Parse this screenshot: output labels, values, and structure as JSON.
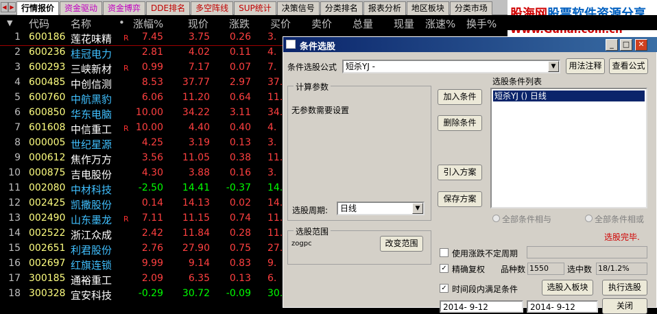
{
  "tabs": [
    {
      "label": "行情报价",
      "color": "#000000"
    },
    {
      "label": "资金驱动",
      "color": "#c000c0"
    },
    {
      "label": "资金博弈",
      "color": "#c000c0"
    },
    {
      "label": "DDE排名",
      "color": "#c00000"
    },
    {
      "label": "多空阵线",
      "color": "#c00000"
    },
    {
      "label": "SUP统计",
      "color": "#c00000"
    },
    {
      "label": "决策信号",
      "color": "#000000"
    },
    {
      "label": "分类排名",
      "color": "#000000"
    },
    {
      "label": "报表分析",
      "color": "#000000"
    },
    {
      "label": "地区板块",
      "color": "#000000"
    },
    {
      "label": "分类市场",
      "color": "#000000"
    }
  ],
  "logo": {
    "line1a": "股海网",
    "line1b": "股票软件资源分享",
    "line2": "Www.Guhai.com.cn"
  },
  "header": {
    "arrow": "▼",
    "code": "代码",
    "name": "名称",
    "dot": "•",
    "pct": "涨幅%",
    "price": "现价",
    "chg": "涨跌",
    "bid": "买价",
    "ask": "卖价",
    "vol": "总量",
    "cur": "现量",
    "speed": "涨速%",
    "turn": "换手%"
  },
  "rows": [
    {
      "idx": "1",
      "code": "600186",
      "name": "莲花味精",
      "r": "R",
      "pct": "7.45",
      "price": "3.75",
      "chg": "0.26",
      "bid": "3.",
      "nameColor": "#ffffff"
    },
    {
      "idx": "2",
      "code": "600236",
      "name": "桂冠电力",
      "r": "",
      "pct": "2.81",
      "price": "4.02",
      "chg": "0.11",
      "bid": "4.",
      "nameColor": "#40c0ff"
    },
    {
      "idx": "3",
      "code": "600293",
      "name": "三峡新材",
      "r": "R",
      "pct": "0.99",
      "price": "7.17",
      "chg": "0.07",
      "bid": "7.",
      "nameColor": "#ffffff"
    },
    {
      "idx": "4",
      "code": "600485",
      "name": "中创信测",
      "r": "",
      "pct": "8.53",
      "price": "37.77",
      "chg": "2.97",
      "bid": "37.",
      "nameColor": "#ffffff"
    },
    {
      "idx": "5",
      "code": "600760",
      "name": "中航黑豹",
      "r": "",
      "pct": "6.06",
      "price": "11.20",
      "chg": "0.64",
      "bid": "11.",
      "nameColor": "#40c0ff"
    },
    {
      "idx": "6",
      "code": "600850",
      "name": "华东电脑",
      "r": "",
      "pct": "10.00",
      "price": "34.22",
      "chg": "3.11",
      "bid": "34.",
      "nameColor": "#40c0ff"
    },
    {
      "idx": "7",
      "code": "601608",
      "name": "中信重工",
      "r": "R",
      "pct": "10.00",
      "price": "4.40",
      "chg": "0.40",
      "bid": "4.",
      "nameColor": "#ffffff"
    },
    {
      "idx": "8",
      "code": "000005",
      "name": "世纪星源",
      "r": "",
      "pct": "4.25",
      "price": "3.19",
      "chg": "0.13",
      "bid": "3.",
      "nameColor": "#40c0ff"
    },
    {
      "idx": "9",
      "code": "000612",
      "name": "焦作万方",
      "r": "",
      "pct": "3.56",
      "price": "11.05",
      "chg": "0.38",
      "bid": "11.",
      "nameColor": "#ffffff"
    },
    {
      "idx": "10",
      "code": "000875",
      "name": "吉电股份",
      "r": "",
      "pct": "4.30",
      "price": "3.88",
      "chg": "0.16",
      "bid": "3.",
      "nameColor": "#ffffff"
    },
    {
      "idx": "11",
      "code": "002080",
      "name": "中材科技",
      "r": "",
      "pct": "-2.50",
      "price": "14.41",
      "chg": "-0.37",
      "bid": "14.",
      "nameColor": "#40c0ff"
    },
    {
      "idx": "12",
      "code": "002425",
      "name": "凯撒股份",
      "r": "",
      "pct": "0.14",
      "price": "14.13",
      "chg": "0.02",
      "bid": "14.",
      "nameColor": "#40c0ff"
    },
    {
      "idx": "13",
      "code": "002490",
      "name": "山东墨龙",
      "r": "R",
      "pct": "7.11",
      "price": "11.15",
      "chg": "0.74",
      "bid": "11.",
      "nameColor": "#40c0ff"
    },
    {
      "idx": "14",
      "code": "002522",
      "name": "浙江众成",
      "r": "",
      "pct": "2.42",
      "price": "11.84",
      "chg": "0.28",
      "bid": "11.",
      "nameColor": "#ffffff"
    },
    {
      "idx": "15",
      "code": "002651",
      "name": "利君股份",
      "r": "",
      "pct": "2.76",
      "price": "27.90",
      "chg": "0.75",
      "bid": "27.",
      "nameColor": "#40c0ff"
    },
    {
      "idx": "16",
      "code": "002697",
      "name": "红旗连锁",
      "r": "",
      "pct": "9.99",
      "price": "9.14",
      "chg": "0.83",
      "bid": "9.",
      "nameColor": "#40c0ff"
    },
    {
      "idx": "17",
      "code": "300185",
      "name": "通裕重工",
      "r": "",
      "pct": "2.09",
      "price": "6.35",
      "chg": "0.13",
      "bid": "6.",
      "nameColor": "#ffffff"
    },
    {
      "idx": "18",
      "code": "300328",
      "name": "宜安科技",
      "r": "",
      "pct": "-0.29",
      "price": "30.72",
      "chg": "-0.09",
      "bid": "30.",
      "nameColor": "#ffffff"
    }
  ],
  "colors": {
    "up": "#ff4040",
    "down": "#00ff00",
    "code": "#ffff80",
    "index": "#c0c0c0"
  },
  "dialog": {
    "title": "条件选股",
    "formula_label": "条件选股公式",
    "formula_value": "短杀YJ  -",
    "usage_btn": "用法注释",
    "view_btn": "查看公式",
    "params_title": "计算参数",
    "no_params": "无参数需要设置",
    "add_btn": "加入条件",
    "del_btn": "删除条件",
    "import_btn": "引入方案",
    "save_btn": "保存方案",
    "list_title": "选股条件列表",
    "list_item": "短杀YJ () 日线",
    "period_label": "选股周期:",
    "period_value": "日线",
    "radio_and": "全部条件相与",
    "radio_or": "全部条件相或",
    "scope_title": "选股范围",
    "scope_value": "zogpc",
    "change_scope_btn": "改变范围",
    "done_text": "选股完毕.",
    "use_unfixed": "使用涨跌不定周期",
    "exact_fq": "精确复权",
    "kinds_label": "品种数",
    "kinds_value": "1550",
    "selected_label": "选中数",
    "selected_value": "18/1.2%",
    "time_cond": "时间段内满足条件",
    "to_block_btn": "选股入板块",
    "exec_btn": "执行选股",
    "date_from": "2014- 9-12",
    "date_to": "2014- 9-12",
    "close_btn": "关闭",
    "min_glyph": "_",
    "max_glyph": "□",
    "close_glyph": "✕",
    "check_glyph": "✓",
    "arrow_glyph": "▼"
  }
}
